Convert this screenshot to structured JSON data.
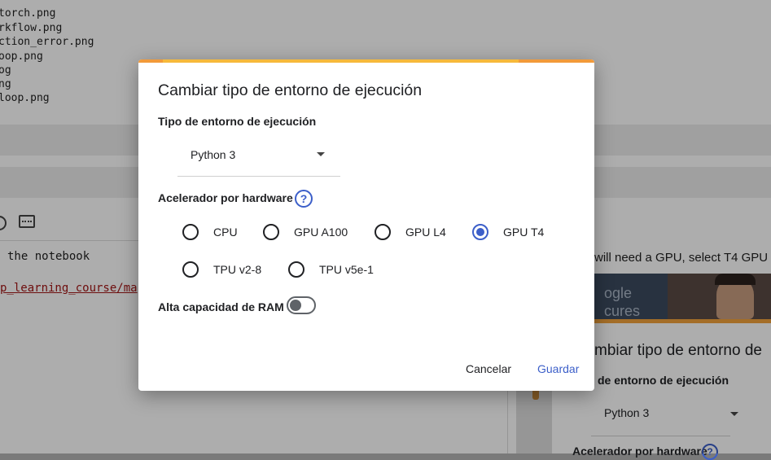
{
  "background": {
    "file_list": [
      "torch.png",
      "rkflow.png",
      "ction_error.png",
      "oop.png",
      "og",
      "ng",
      "loop.png"
    ],
    "notebook_text": "the notebook",
    "notebook_link": "p_learning_course/ma",
    "right_text": "will need a GPU, select T4 GPU",
    "thumb_text_1": "ogle",
    "thumb_text_2": "cures",
    "mini_dialog": {
      "title": "mbiar tipo de entorno de",
      "runtime_label": "de entorno de ejecución",
      "runtime_value": "Python 3",
      "accel_label": "Acelerador por hardware",
      "help_symbol": "?"
    }
  },
  "dialog": {
    "title": "Cambiar tipo de entorno de ejecución",
    "runtime_label": "Tipo de entorno de ejecución",
    "runtime_value": "Python 3",
    "accel_label": "Acelerador por hardware",
    "help_symbol": "?",
    "accelerators": [
      {
        "label": "CPU",
        "selected": false
      },
      {
        "label": "GPU A100",
        "selected": false
      },
      {
        "label": "GPU L4",
        "selected": false
      },
      {
        "label": "GPU T4",
        "selected": true
      },
      {
        "label": "TPU v2-8",
        "selected": false
      },
      {
        "label": "TPU v5e-1",
        "selected": false
      }
    ],
    "high_ram_label": "Alta capacidad de RAM",
    "high_ram_enabled": false,
    "cancel_label": "Cancelar",
    "save_label": "Guardar"
  },
  "colors": {
    "accent_blue": "#3c5fc9",
    "bar_orange": "#f29a3a",
    "bar_yellow": "#f6b93b",
    "link_red": "#a31515"
  }
}
